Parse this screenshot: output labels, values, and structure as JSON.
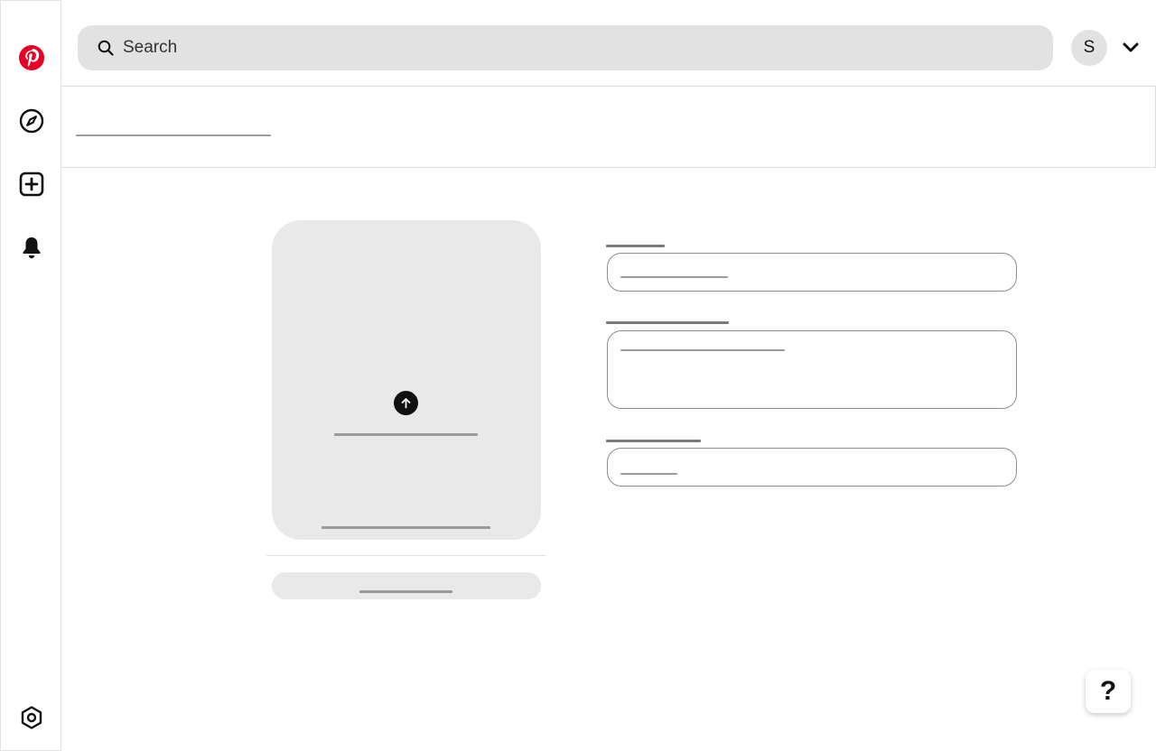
{
  "header": {
    "search_placeholder": "Search",
    "avatar_initial": "S"
  },
  "help": {
    "label": "?"
  },
  "icons": {
    "logo": "pinterest-logo-icon",
    "explore": "compass-icon",
    "create": "plus-square-icon",
    "notifications": "bell-icon",
    "settings": "gear-icon",
    "search": "search-icon",
    "account_menu": "chevron-down-icon",
    "upload": "arrow-up-icon"
  },
  "colors": {
    "brand": "#e60023",
    "surface": "#e9e9e9",
    "search_bg": "#e2e2e2"
  }
}
